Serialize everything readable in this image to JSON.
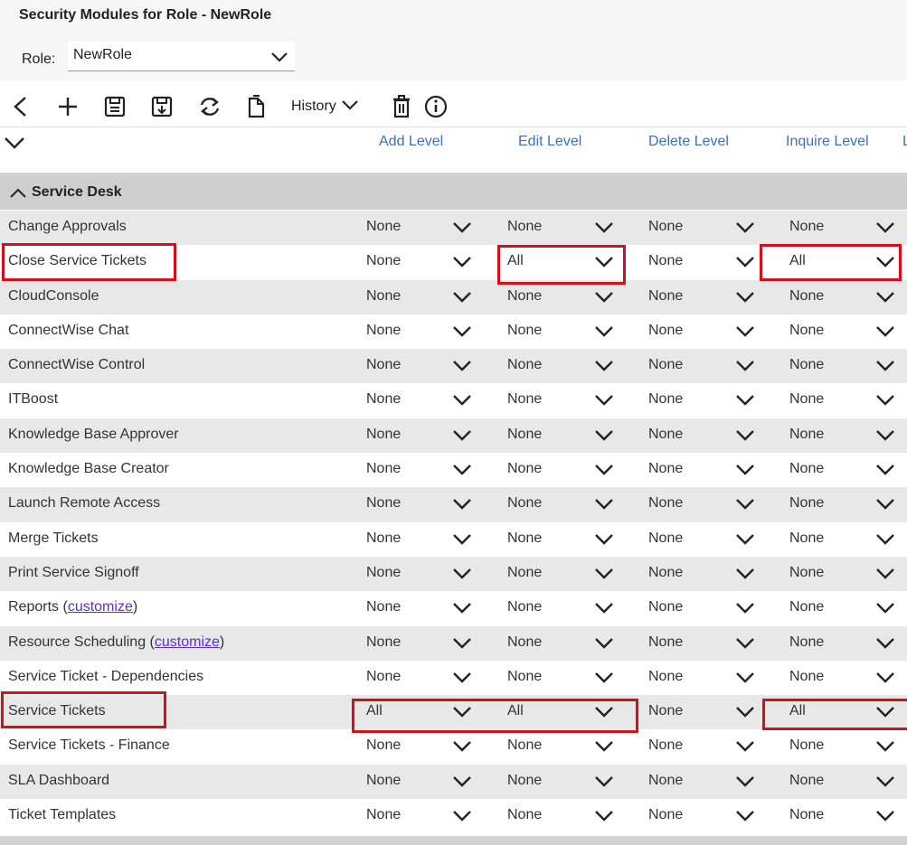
{
  "page": {
    "title": "Security Modules for Role - NewRole"
  },
  "role": {
    "label": "Role:",
    "value": "NewRole"
  },
  "toolbar": {
    "history_label": "History"
  },
  "columns": [
    "Add Level",
    "Edit Level",
    "Delete Level",
    "Inquire Level",
    "L"
  ],
  "group": {
    "label": "Service Desk"
  },
  "rows": [
    {
      "name": "Change Approvals",
      "levels": [
        "None",
        "None",
        "None",
        "None"
      ]
    },
    {
      "name": "Close Service Tickets",
      "levels": [
        "None",
        "All",
        "None",
        "All"
      ]
    },
    {
      "name": "CloudConsole",
      "levels": [
        "None",
        "None",
        "None",
        "None"
      ]
    },
    {
      "name": "ConnectWise Chat",
      "levels": [
        "None",
        "None",
        "None",
        "None"
      ]
    },
    {
      "name": "ConnectWise Control",
      "levels": [
        "None",
        "None",
        "None",
        "None"
      ]
    },
    {
      "name": "ITBoost",
      "levels": [
        "None",
        "None",
        "None",
        "None"
      ]
    },
    {
      "name": "Knowledge Base Approver",
      "levels": [
        "None",
        "None",
        "None",
        "None"
      ]
    },
    {
      "name": "Knowledge Base Creator",
      "levels": [
        "None",
        "None",
        "None",
        "None"
      ]
    },
    {
      "name": "Launch Remote Access",
      "levels": [
        "None",
        "None",
        "None",
        "None"
      ]
    },
    {
      "name": "Merge Tickets",
      "levels": [
        "None",
        "None",
        "None",
        "None"
      ]
    },
    {
      "name": "Print Service Signoff",
      "levels": [
        "None",
        "None",
        "None",
        "None"
      ]
    },
    {
      "name": "Reports",
      "link": "customize",
      "levels": [
        "None",
        "None",
        "None",
        "None"
      ]
    },
    {
      "name": "Resource Scheduling",
      "link": "customize",
      "levels": [
        "None",
        "None",
        "None",
        "None"
      ]
    },
    {
      "name": "Service Ticket - Dependencies",
      "levels": [
        "None",
        "None",
        "None",
        "None"
      ]
    },
    {
      "name": "Service Tickets",
      "levels": [
        "All",
        "All",
        "None",
        "All"
      ]
    },
    {
      "name": "Service Tickets - Finance",
      "levels": [
        "None",
        "None",
        "None",
        "None"
      ]
    },
    {
      "name": "SLA Dashboard",
      "levels": [
        "None",
        "None",
        "None",
        "None"
      ]
    },
    {
      "name": "Ticket Templates",
      "levels": [
        "None",
        "None",
        "None",
        "None"
      ]
    }
  ],
  "colors": {
    "highlight": "#d0101a",
    "header_link": "#3f6fb5",
    "link": "#5b2fc9"
  }
}
